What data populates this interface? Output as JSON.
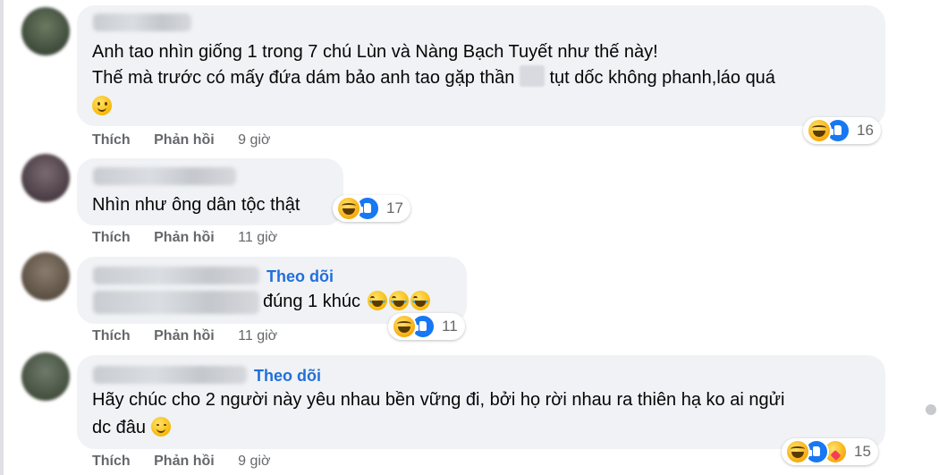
{
  "comments": [
    {
      "follow_label": "",
      "lines": [
        "Anh tao nhìn giống 1 trong 7 chú Lùn và Nàng Bạch Tuyết như thế này!",
        "Thế mà trước có mấy đứa dám bảo anh tao gặp thần",
        "tụt dốc không phanh,láo quá"
      ],
      "actions": {
        "like": "Thích",
        "reply": "Phản hồi",
        "time": "9 giờ"
      },
      "reaction_count": "16"
    },
    {
      "follow_label": "",
      "lines": [
        "Nhìn như ông dân tộc thật"
      ],
      "actions": {
        "like": "Thích",
        "reply": "Phản hồi",
        "time": "11 giờ"
      },
      "reaction_count": "17"
    },
    {
      "follow_label": "Theo dõi",
      "lines": [
        "đúng 1 khúc"
      ],
      "actions": {
        "like": "Thích",
        "reply": "Phản hồi",
        "time": "11 giờ"
      },
      "reaction_count": "11"
    },
    {
      "follow_label": "Theo dõi",
      "lines": [
        "Hãy chúc cho 2 người này yêu nhau bền vững đi, bởi họ rời nhau ra thiên hạ ko ai ngửi",
        "dc đâu"
      ],
      "actions": {
        "like": "Thích",
        "reply": "Phản hồi",
        "time": "9 giờ"
      },
      "reaction_count": "15"
    }
  ],
  "icons": {
    "like": "like-reaction-icon",
    "haha": "haha-reaction-icon",
    "care": "care-reaction-icon"
  },
  "colors": {
    "bubble": "#f0f2f5",
    "link": "#216fdb",
    "meta": "#65676b",
    "like_blue": "#1877f2"
  }
}
